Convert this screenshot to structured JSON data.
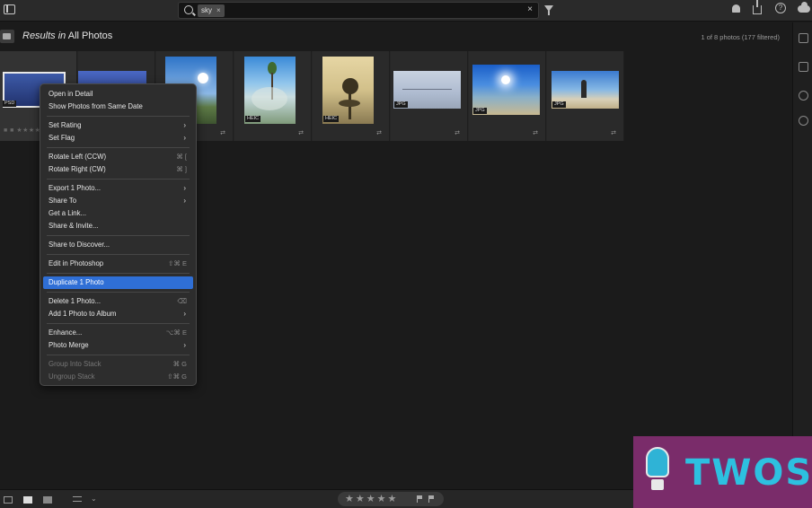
{
  "search": {
    "chip": "sky",
    "chip_close": "×",
    "clear": "×"
  },
  "header": {
    "results_prefix": "Results in",
    "results_scope": "All Photos",
    "count": "1 of 8 photos (177 filtered)"
  },
  "photos": [
    {
      "badge": "PSD",
      "selected": true
    },
    {
      "badge": "",
      "selected": false
    },
    {
      "badge": "",
      "selected": false
    },
    {
      "badge": "HEIC",
      "selected": false
    },
    {
      "badge": "HEIC",
      "selected": false
    },
    {
      "badge": "JPG",
      "selected": false
    },
    {
      "badge": "JPG",
      "selected": false
    },
    {
      "badge": "JPG",
      "selected": false
    }
  ],
  "context_menu": {
    "open_detail": "Open in Detail",
    "same_date": "Show Photos from Same Date",
    "set_rating": "Set Rating",
    "set_flag": "Set Flag",
    "rotate_left": "Rotate Left (CCW)",
    "rotate_left_sc": "⌘ [",
    "rotate_right": "Rotate Right (CW)",
    "rotate_right_sc": "⌘ ]",
    "export": "Export 1 Photo...",
    "share_to": "Share To",
    "get_link": "Get a Link...",
    "share_invite": "Share & Invite...",
    "share_discover": "Share to Discover...",
    "edit_ps": "Edit in Photoshop",
    "edit_ps_sc": "⇧⌘ E",
    "duplicate": "Duplicate 1 Photo",
    "delete": "Delete 1 Photo...",
    "delete_sc": "⌫",
    "add_album": "Add 1 Photo to Album",
    "enhance": "Enhance...",
    "enhance_sc": "⌥⌘ E",
    "photo_merge": "Photo Merge",
    "group_stack": "Group Into Stack",
    "group_stack_sc": "⌘ G",
    "ungroup_stack": "Ungroup Stack",
    "ungroup_stack_sc": "⇧⌘ G",
    "submenu_arrow": "›"
  },
  "bottom": {
    "stars": "★★★★★"
  },
  "watermark": {
    "text": "TWOS"
  },
  "colors": {
    "highlight": "#2f6fd6",
    "watermark_bg": "#7a2c6a",
    "watermark_text": "#2dc0e0"
  }
}
